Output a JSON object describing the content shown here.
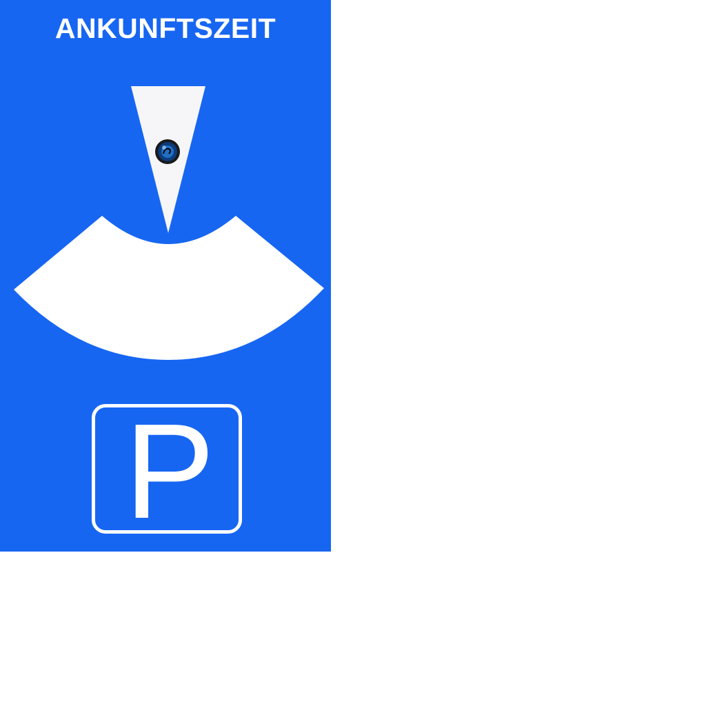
{
  "card": {
    "title": "ANKUNFTSZEIT",
    "sign_letter": "P",
    "colors": {
      "background": "#1766f2",
      "foreground": "#ffffff",
      "pointer": "#f6f6f8",
      "rivet": "#0a2a55"
    },
    "icons": [
      "time-pointer-icon",
      "rivet-icon",
      "dial-window-icon",
      "parking-sign-icon"
    ]
  }
}
